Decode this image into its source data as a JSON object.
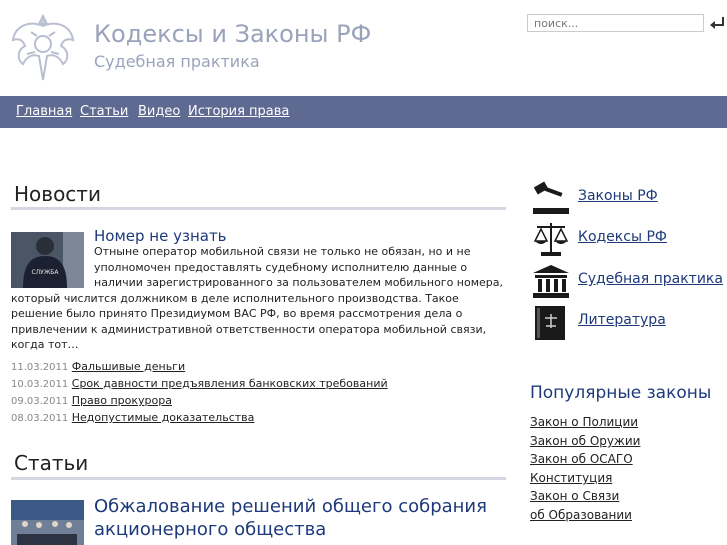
{
  "header": {
    "title": "Кодексы и Законы РФ",
    "subtitle": "Судебная практика",
    "search_placeholder": "поиск..."
  },
  "nav": [
    {
      "label": "Главная"
    },
    {
      "label": "Статьи"
    },
    {
      "label": "Видео"
    },
    {
      "label": "История права"
    }
  ],
  "news": {
    "heading": "Новости",
    "featured": {
      "title": "Номер не узнать",
      "image_label": "СЛУЖБА",
      "body": "Отныне оператор мобильной связи не только не обязан, но и не уполномочен предоставлять судебному исполнителю данные о наличии зарегистрированного за пользователем мобильного номера, который числится должником в деле исполнительного производства. Такое решение было принято Президиумом ВАС РФ, во время рассмотрения дела о привлечении к административной ответственности оператора мобильной связи, когда тот…"
    },
    "items": [
      {
        "date": "11.03.2011",
        "title": "Фальшивые деньги"
      },
      {
        "date": "10.03.2011",
        "title": "Срок давности предъявления банковских требований"
      },
      {
        "date": "09.03.2011",
        "title": "Право прокурора"
      },
      {
        "date": "08.03.2011",
        "title": "Недопустимые доказательства"
      }
    ]
  },
  "articles": {
    "heading": "Статьи",
    "featured_title": "Обжалование решений общего собрания акционерного общества"
  },
  "sidebar": {
    "links": [
      {
        "label": "Законы РФ",
        "icon": "gavel-icon"
      },
      {
        "label": "Кодексы РФ",
        "icon": "scales-icon"
      },
      {
        "label": "Судебная практика",
        "icon": "courthouse-icon"
      },
      {
        "label": "Литература",
        "icon": "book-icon"
      }
    ],
    "popular_title": "Популярные законы",
    "popular": [
      "Закон о Полиции",
      "Закон об Оружии",
      "Закон об ОСАГО",
      "Конституция",
      "Закон о Связи",
      "об Образовании"
    ]
  },
  "colors": {
    "nav_bg": "#5e6a92",
    "link_blue": "#1e3a7a",
    "header_text": "#9aa3bb"
  }
}
